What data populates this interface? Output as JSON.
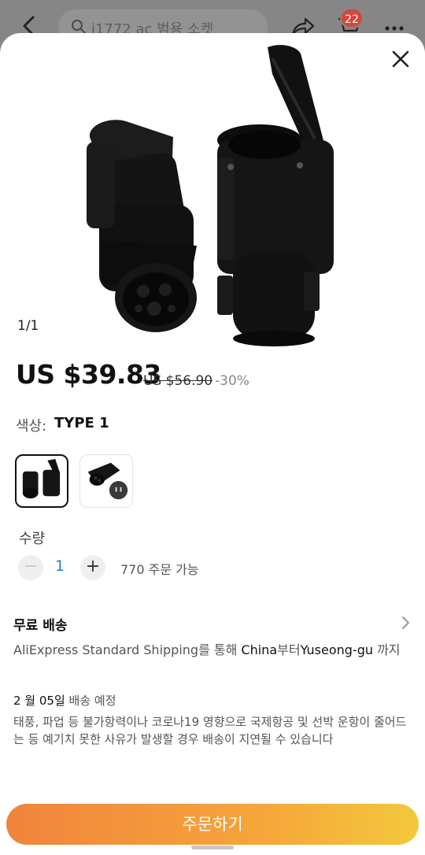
{
  "header": {
    "search_text": "j1772 ac 범용 소켓",
    "cart_count": "22",
    "icons": [
      "back-arrow-icon",
      "search-icon",
      "share-icon",
      "cart-icon",
      "more-icon"
    ]
  },
  "sheet": {
    "image_counter": "1/1",
    "price": "US $39.83",
    "original_price": "US $56.90",
    "discount": "-30%",
    "color_label": "색상:",
    "color_value": "TYPE 1",
    "quantity_label": "수량",
    "quantity_minus": "−",
    "quantity_value": "1",
    "quantity_plus": "+",
    "quantity_available": "770 주문 가능",
    "shipping_title": "무료 배송",
    "shipping_desc": {
      "carrier": "AliExpress Standard Shipping",
      "via": "를 통해 ",
      "origin": "China",
      "from": "부터",
      "destination": "Yuseong-gu",
      "to": " 까지"
    },
    "delivery_date": "2 월 05일",
    "delivery_suffix": " 배송 예정",
    "notice": "태풍, 파업 등 불가항력이나 코로나19 영향으로 국제항공 및 선박 운항이 줄어드는 등 예기치 못한 사유가 발생할 경우 배송이 지연될 수 있습니다",
    "order_button": "주문하기"
  },
  "colors": {
    "accent_start": "#f0843c",
    "accent_end": "#f3c83c",
    "badge": "#d9443b",
    "quantity_value": "#2a7bd6"
  }
}
